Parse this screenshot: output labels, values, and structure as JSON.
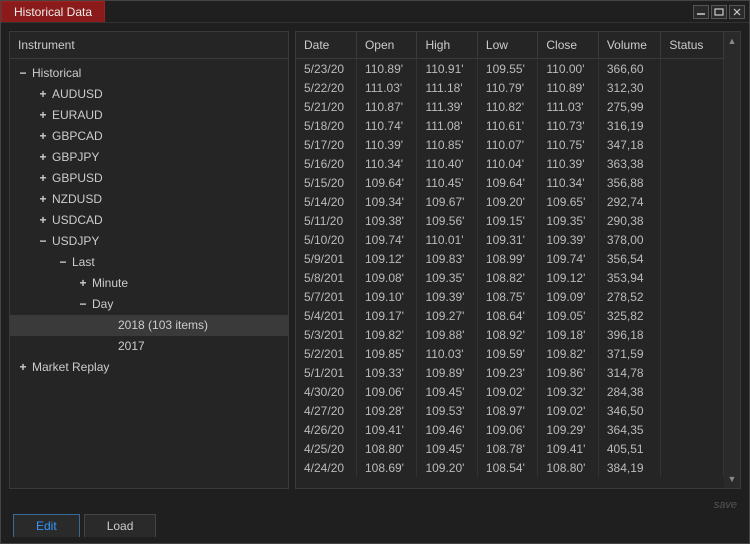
{
  "window": {
    "title": "Historical Data"
  },
  "tree": {
    "header": "Instrument",
    "historical": {
      "label": "Historical",
      "items": [
        "AUDUSD",
        "EURAUD",
        "GBPCAD",
        "GBPJPY",
        "GBPUSD",
        "NZDUSD",
        "USDCAD"
      ],
      "usdjpy": {
        "label": "USDJPY",
        "last": "Last",
        "minute": "Minute",
        "day": "Day",
        "y2018": "2018 (103 items)",
        "y2017": "2017"
      }
    },
    "market_replay": "Market Replay"
  },
  "table": {
    "headers": [
      "Date",
      "Open",
      "High",
      "Low",
      "Close",
      "Volume",
      "Status"
    ],
    "rows": [
      [
        "5/23/20",
        "110.89'",
        "110.91'",
        "109.55'",
        "110.00'",
        "366,60",
        ""
      ],
      [
        "5/22/20",
        "111.03'",
        "111.18'",
        "110.79'",
        "110.89'",
        "312,30",
        ""
      ],
      [
        "5/21/20",
        "110.87'",
        "111.39'",
        "110.82'",
        "111.03'",
        "275,99",
        ""
      ],
      [
        "5/18/20",
        "110.74'",
        "111.08'",
        "110.61'",
        "110.73'",
        "316,19",
        ""
      ],
      [
        "5/17/20",
        "110.39'",
        "110.85'",
        "110.07'",
        "110.75'",
        "347,18",
        ""
      ],
      [
        "5/16/20",
        "110.34'",
        "110.40'",
        "110.04'",
        "110.39'",
        "363,38",
        ""
      ],
      [
        "5/15/20",
        "109.64'",
        "110.45'",
        "109.64'",
        "110.34'",
        "356,88",
        ""
      ],
      [
        "5/14/20",
        "109.34'",
        "109.67'",
        "109.20'",
        "109.65'",
        "292,74",
        ""
      ],
      [
        "5/11/20",
        "109.38'",
        "109.56'",
        "109.15'",
        "109.35'",
        "290,38",
        ""
      ],
      [
        "5/10/20",
        "109.74'",
        "110.01'",
        "109.31'",
        "109.39'",
        "378,00",
        ""
      ],
      [
        "5/9/201",
        "109.12'",
        "109.83'",
        "108.99'",
        "109.74'",
        "356,54",
        ""
      ],
      [
        "5/8/201",
        "109.08'",
        "109.35'",
        "108.82'",
        "109.12'",
        "353,94",
        ""
      ],
      [
        "5/7/201",
        "109.10'",
        "109.39'",
        "108.75'",
        "109.09'",
        "278,52",
        ""
      ],
      [
        "5/4/201",
        "109.17'",
        "109.27'",
        "108.64'",
        "109.05'",
        "325,82",
        ""
      ],
      [
        "5/3/201",
        "109.82'",
        "109.88'",
        "108.92'",
        "109.18'",
        "396,18",
        ""
      ],
      [
        "5/2/201",
        "109.85'",
        "110.03'",
        "109.59'",
        "109.82'",
        "371,59",
        ""
      ],
      [
        "5/1/201",
        "109.33'",
        "109.89'",
        "109.23'",
        "109.86'",
        "314,78",
        ""
      ],
      [
        "4/30/20",
        "109.06'",
        "109.45'",
        "109.02'",
        "109.32'",
        "284,38",
        ""
      ],
      [
        "4/27/20",
        "109.28'",
        "109.53'",
        "108.97'",
        "109.02'",
        "346,50",
        ""
      ],
      [
        "4/26/20",
        "109.41'",
        "109.46'",
        "109.06'",
        "109.29'",
        "364,35",
        ""
      ],
      [
        "4/25/20",
        "108.80'",
        "109.45'",
        "108.78'",
        "109.41'",
        "405,51",
        ""
      ],
      [
        "4/24/20",
        "108.69'",
        "109.20'",
        "108.54'",
        "108.80'",
        "384,19",
        ""
      ]
    ]
  },
  "footer": {
    "hint": "save",
    "tab_edit": "Edit",
    "tab_load": "Load"
  }
}
